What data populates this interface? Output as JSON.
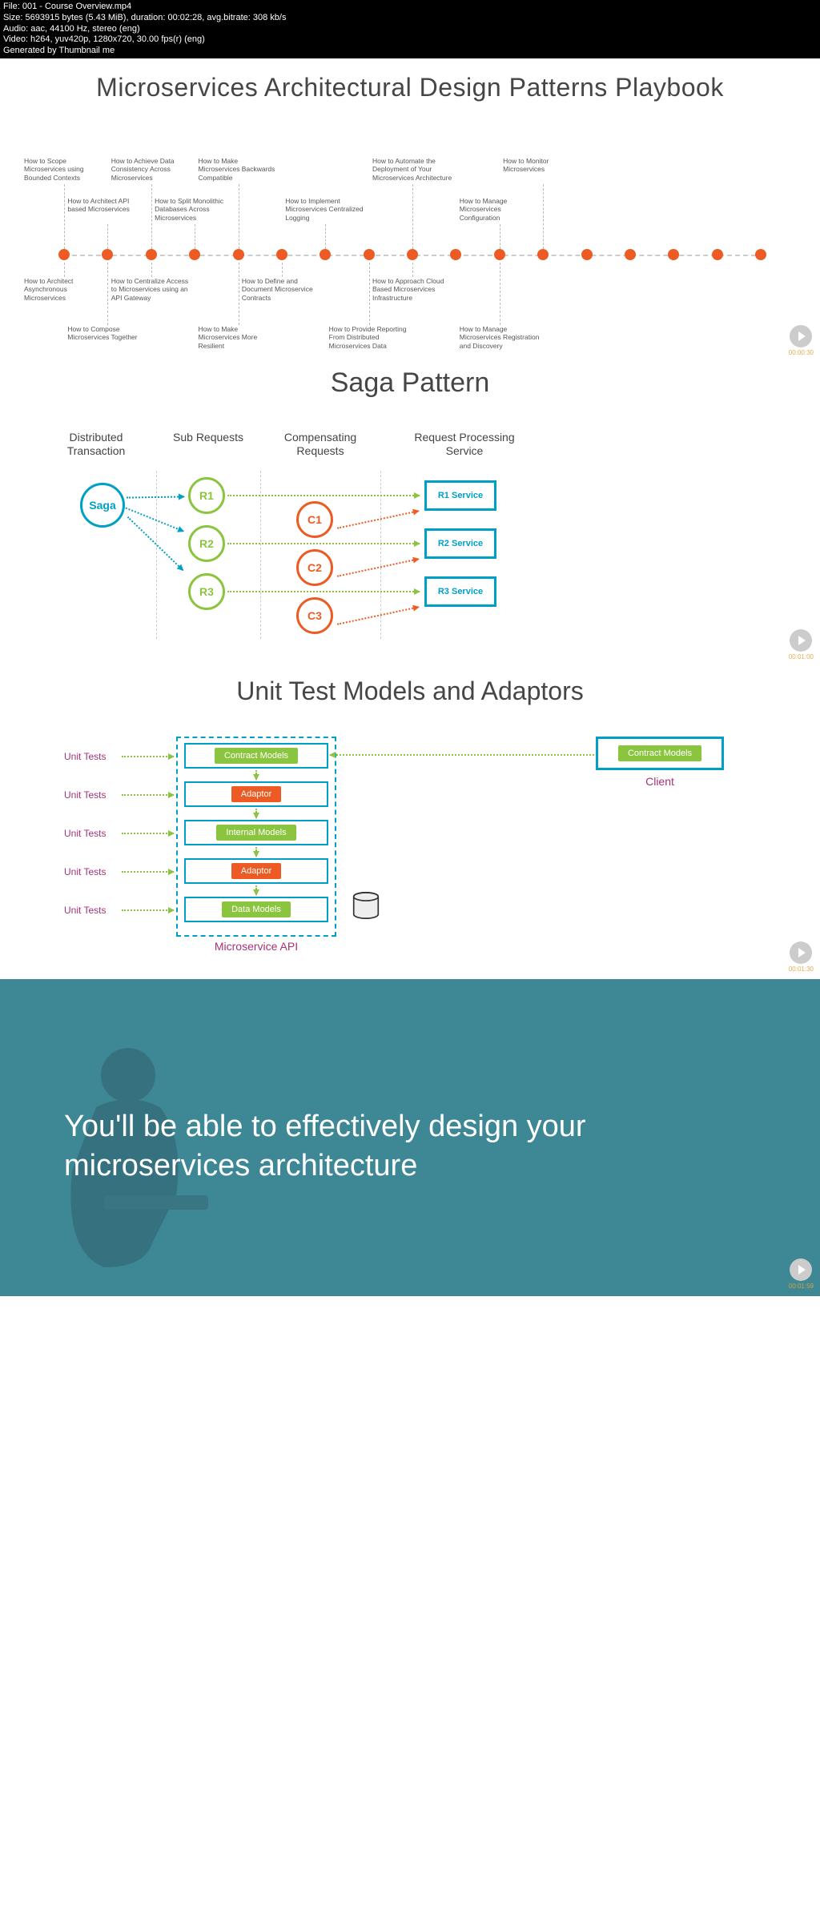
{
  "meta": {
    "file": "File: 001 - Course Overview.mp4",
    "size": "Size: 5693915 bytes (5.43 MiB), duration: 00:02:28, avg.bitrate: 308 kb/s",
    "audio": "Audio: aac, 44100 Hz, stereo (eng)",
    "video": "Video: h264, yuv420p, 1280x720, 30.00 fps(r) (eng)",
    "gen": "Generated by Thumbnail me"
  },
  "s1": {
    "title": "Microservices Architectural Design Patterns Playbook",
    "labels_top1": [
      "How to Scope Microservices using Bounded Contexts",
      "How to Achieve Data Consistency Across Microservices",
      "How to Make Microservices Backwards Compatible",
      "How to Automate the Deployment of Your Microservices Architecture",
      "How to Monitor Microservices"
    ],
    "labels_top2": [
      "How to Architect API based Microservices",
      "How to Split Monolithic Databases Across Microservices",
      "How to Implement Microservices Centralized Logging",
      "How to Manage Microservices Configuration"
    ],
    "labels_bot1": [
      "How to Architect Asynchronous Microservices",
      "How to Centralize Access to Microservices using an API Gateway",
      "How to Define and Document Microservice Contracts",
      "How to Approach Cloud Based Microservices Infrastructure"
    ],
    "labels_bot2": [
      "How to Compose Microservices Together",
      "How to Make Microservices More Resilient",
      "How to Provide Reporting From Distributed Microservices Data",
      "How to Manage Microservices Registration and Discovery"
    ],
    "ts": "00:00:30"
  },
  "s2": {
    "title": "Saga Pattern",
    "cols": [
      "Distributed Transaction",
      "Sub Requests",
      "Compensating Requests",
      "Request Processing Service"
    ],
    "saga": "Saga",
    "r": [
      "R1",
      "R2",
      "R3"
    ],
    "c": [
      "C1",
      "C2",
      "C3"
    ],
    "svc": [
      "R1 Service",
      "R2 Service",
      "R3 Service"
    ],
    "ts": "00:01:00"
  },
  "s3": {
    "title": "Unit Test Models and Adaptors",
    "ut": "Unit Tests",
    "layers": [
      "Contract Models",
      "Adaptor",
      "Internal Models",
      "Adaptor",
      "Data Models"
    ],
    "api": "Microservice API",
    "client_pill": "Contract Models",
    "client": "Client",
    "ts": "00:01:30"
  },
  "s4": {
    "text": "You'll be able to effectively design your microservices architecture",
    "ts": "00:01:59"
  }
}
